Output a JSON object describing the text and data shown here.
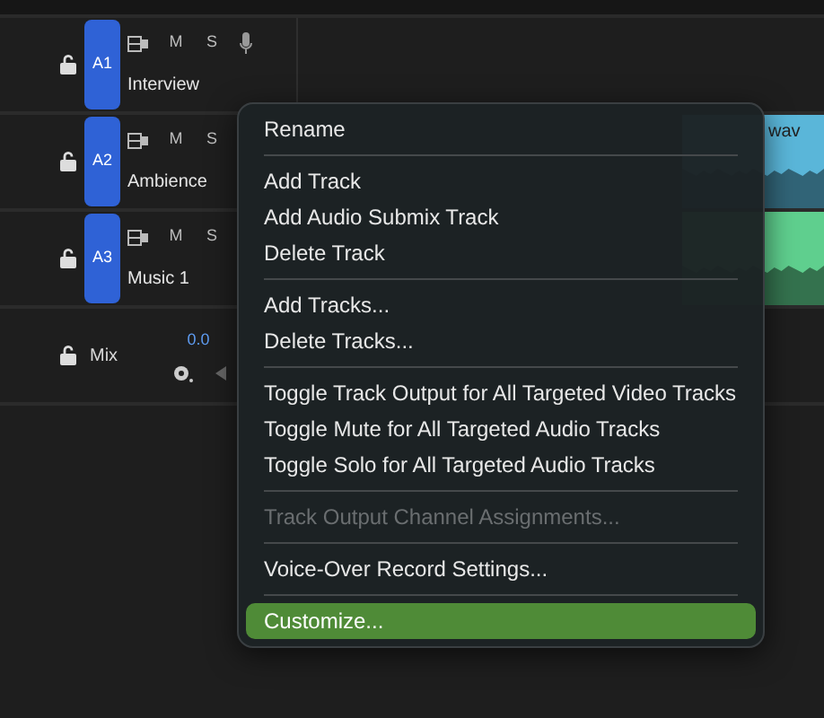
{
  "tracks": [
    {
      "label": "A1",
      "name": "Interview",
      "buttons": [
        "M",
        "S"
      ],
      "voice_over": true
    },
    {
      "label": "A2",
      "name": "Ambience",
      "buttons": [
        "M",
        "S"
      ],
      "clip": {
        "label": "wav",
        "color": "#5ab6d9"
      }
    },
    {
      "label": "A3",
      "name": "Music 1",
      "buttons": [
        "M",
        "S"
      ],
      "clip": {
        "color": "#5fcf8e"
      }
    }
  ],
  "mix": {
    "name": "Mix",
    "reading": "0.0"
  },
  "context_menu": [
    [
      {
        "label": "Rename",
        "disabled": false,
        "selected": false
      }
    ],
    [
      {
        "label": "Add Track",
        "disabled": false,
        "selected": false
      },
      {
        "label": "Add Audio Submix Track",
        "disabled": false,
        "selected": false
      },
      {
        "label": "Delete Track",
        "disabled": false,
        "selected": false
      }
    ],
    [
      {
        "label": "Add Tracks...",
        "disabled": false,
        "selected": false
      },
      {
        "label": "Delete Tracks...",
        "disabled": false,
        "selected": false
      }
    ],
    [
      {
        "label": "Toggle Track Output for All Targeted Video Tracks",
        "disabled": false,
        "selected": false
      },
      {
        "label": "Toggle Mute for All Targeted Audio Tracks",
        "disabled": false,
        "selected": false
      },
      {
        "label": "Toggle Solo for All Targeted Audio Tracks",
        "disabled": false,
        "selected": false
      }
    ],
    [
      {
        "label": "Track Output Channel Assignments...",
        "disabled": true,
        "selected": false
      }
    ],
    [
      {
        "label": "Voice-Over Record Settings...",
        "disabled": false,
        "selected": false
      }
    ],
    [
      {
        "label": "Customize...",
        "disabled": false,
        "selected": true
      }
    ]
  ]
}
